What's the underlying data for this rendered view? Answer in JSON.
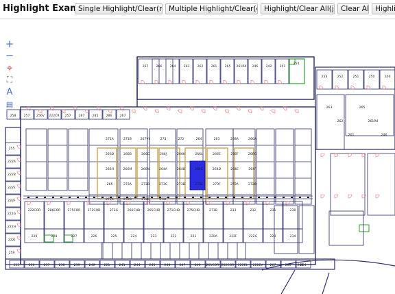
{
  "toolbar": {
    "title": "Highlight Example",
    "buttons": [
      "Single Highlight/Clear(rm)",
      "Multiple Highlight/Clear(eq)",
      "Highlight/Clear All(jk)",
      "Clear All",
      "Highlig"
    ]
  },
  "zoom_controls": [
    "zoom-in",
    "zoom-out",
    "locate",
    "fit",
    "text",
    "layers"
  ],
  "colors": {
    "highlight": "#2a2ee0",
    "walls": "#2a2a6a",
    "doors": "#e36a6a",
    "lab": "#c9a44a",
    "accent": "#2aa02a"
  },
  "floor": {
    "highlighted_room": "266L",
    "rooms": [
      "267",
      "266",
      "264",
      "263",
      "262",
      "261",
      "265",
      "261R4",
      "246",
      "242",
      "241",
      "254",
      "253",
      "252",
      "251",
      "250",
      "256",
      "255",
      "222A",
      "222B",
      "222E",
      "222F",
      "222G",
      "222H",
      "222J",
      "259",
      "258",
      "257",
      "256V",
      "222CR",
      "257",
      "287",
      "285",
      "286",
      "267",
      "271A",
      "271B",
      "267V4",
      "275",
      "272",
      "264",
      "263",
      "268A",
      "266A",
      "266D",
      "266B",
      "266C",
      "266J",
      "266K",
      "266L",
      "266E",
      "266F",
      "266G",
      "266H",
      "266M",
      "266N",
      "264A",
      "264B",
      "264C",
      "264D",
      "264E",
      "264F",
      "265",
      "273A",
      "273B",
      "273C",
      "273D",
      "273E",
      "273F",
      "272A",
      "272B",
      "272C",
      "272D",
      "272E",
      "272F",
      "222COR",
      "286COR",
      "275COR",
      "272COR",
      "272G",
      "266CHB",
      "265CHB",
      "271CHB",
      "275CHB",
      "271B",
      "233",
      "232",
      "231",
      "230",
      "229",
      "228",
      "227",
      "226",
      "225",
      "224",
      "223",
      "222",
      "221",
      "220A",
      "222F",
      "222G",
      "223",
      "234",
      "235",
      "236",
      "237",
      "238",
      "239",
      "240",
      "221",
      "243",
      "244",
      "245",
      "248",
      "247",
      "249",
      "261COR",
      "262COR",
      "222EL",
      "222EV"
    ]
  }
}
